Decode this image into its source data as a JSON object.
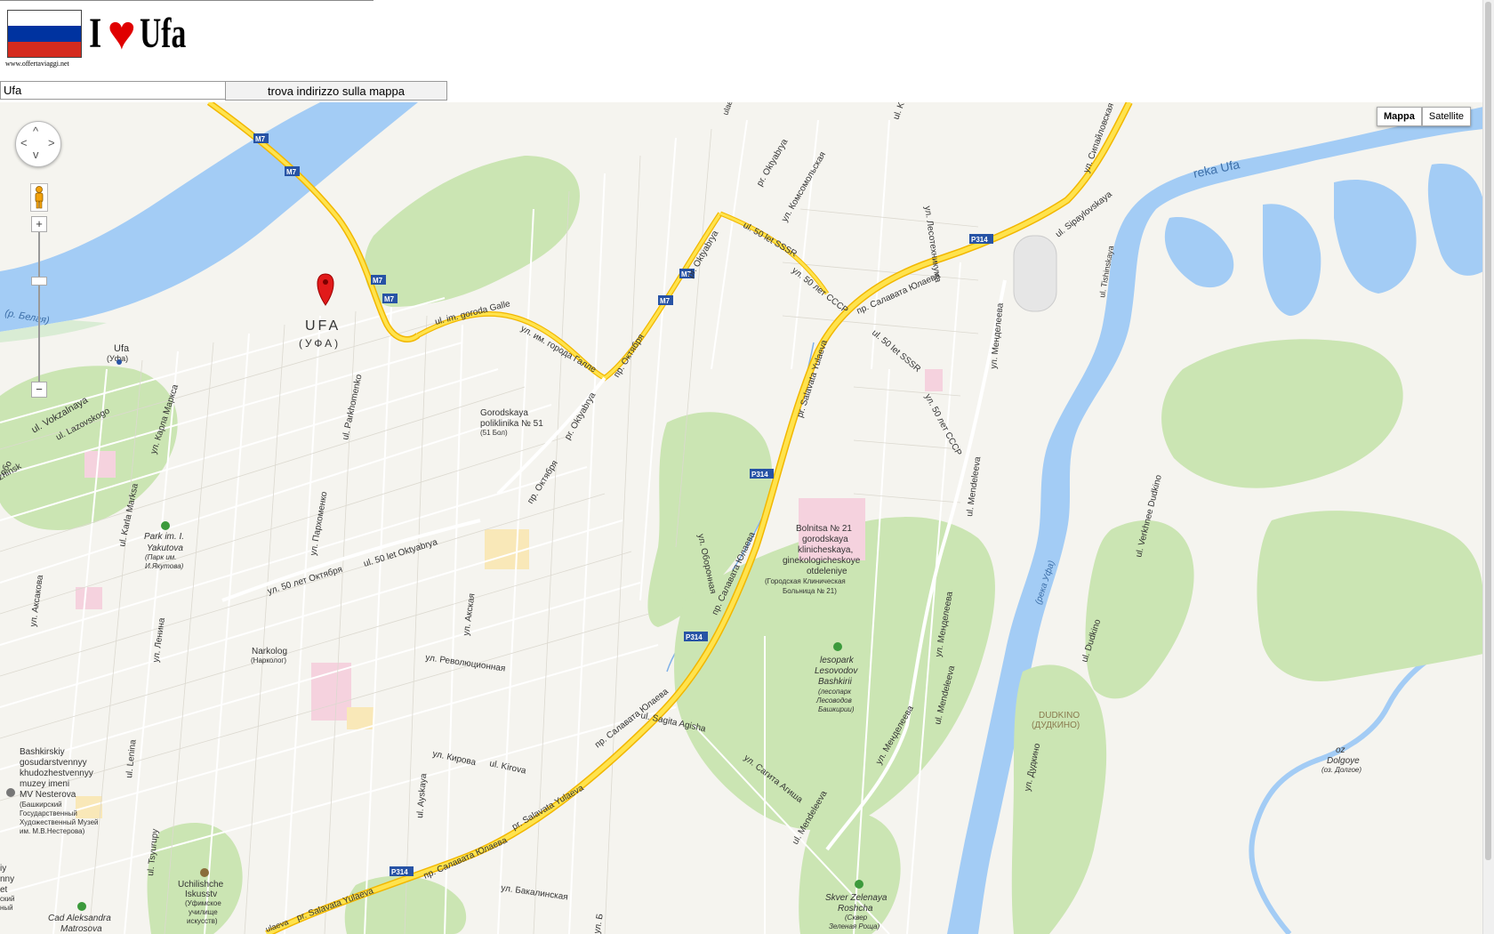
{
  "header": {
    "flag_colors": [
      "#ffffff",
      "#0033a0",
      "#d52b1e"
    ],
    "logo_i": "I",
    "logo_heart": "♥",
    "logo_city": "Ufa",
    "site_url": "www.offertaviaggi.net"
  },
  "search": {
    "address_value": "Ufa",
    "find_button_label": "trova indirizzo sulla mappa"
  },
  "map": {
    "type_buttons": [
      "Mappa",
      "Satellite"
    ],
    "selected_type": "Mappa",
    "zoom_in": "+",
    "zoom_out": "−",
    "marker_city": "UFA",
    "marker_city_ru": "(УФА)",
    "labels": {
      "reka_ufa": "reka Ufa",
      "r_belaya": "(р. Белая)",
      "ufa_station": "Ufa",
      "ufa_station_ru": "(Уфа)",
      "ul_vokzalnaya": "ul. Vokzalnaya",
      "ul_lazovskogo": "ul. Lazovskogo",
      "ul_karla_marksa_ru": "ул. Карла Маркса",
      "ul_karla_marksa": "ul. Karla Marksa",
      "park_yakutova_1": "Park im. I.",
      "park_yakutova_2": "Yakutova",
      "park_yakutova_3": "(Парк им.",
      "park_yakutova_4": "И.Якутова)",
      "ul_aksakova": "ул. Аксакова",
      "ul_lenina_ru": "ул. Ленина",
      "ul_lenina": "ul. Lenina",
      "ul_tsyurupy": "ul. Tsyurupy",
      "ul_parkhomenko": "ul. Parkhomenko",
      "ul_parkhomenko_ru": "ул. Пархоменко",
      "ul_50let_oktyabrya_ru": "ул. 50 лет Октября",
      "ul_50let_oktyabrya": "ul. 50 let Oktyabrya",
      "ul_im_goroda_galle": "ul. im. goroda Galle",
      "ul_im_goroda_galle_ru": "ул. им. города Галле",
      "pr_oktyabrya_ru": "пр. Октября",
      "pr_oktyabrya": "pr. Oktyabrya",
      "pr_oktyabrya_ru2": "пр. Октября",
      "pr_oktyabrya2": "pr. Oktyabrya",
      "pr_oktyabrya3": "pr. Oktyabrya",
      "gorod_polik_1": "Gorodskaya",
      "gorod_polik_2": "poliklinika № 51",
      "gorod_polik_3": "(51 Бол)",
      "ul_komsomolskaya": "ул. Комсомольская",
      "ul_50let_sssr": "ul. 50 let SSSR",
      "ul_50let_sssr_ru": "ул. 50 лет СССР",
      "ul_50let_sssr2": "ul. 50 let SSSR",
      "ul_50let_sssr_ru2": "ул. 50 лет СССР",
      "pr_salavata_ru": "пр. Салавата Юлаева",
      "pr_salavata": "pr. Salavata Yulaeva",
      "pr_salavata_ru2": "пр. Салавата Юлаева",
      "pr_salavata_ru3": "пр. Салавата Юлаева",
      "pr_salavata2": "pr. Salavata Yulaeva",
      "pr_salavata_ru4": "пр. Салавата Юлаева",
      "pr_salavata3": "pr. Salavata Yulaeva",
      "ul_sipaylovskaya": "ul. Sipaylovskaya",
      "ul_sipaylovskaya_ru": "ул. Сипайловская",
      "ul_mendeleeva_ru": "ул. Менделеева",
      "ul_mendeleeva": "ul. Mendeleeva",
      "ul_mendeleeva_ru2": "ул. Менделеева",
      "ul_mendeleeva2": "ul. Mendeleeva",
      "ul_mendeleeva_ru3": "ул. Менделеева",
      "ul_mendeleeva3": "ul. Mendeleeva",
      "ul_oboronnaya": "ул. Оборонная",
      "bolnitsa_1": "Bolnitsa № 21",
      "bolnitsa_2": "gorodskaya",
      "bolnitsa_3": "klinicheskaya,",
      "bolnitsa_4": "ginekologicheskoye",
      "bolnitsa_5": "otdeleniye",
      "bolnitsa_6": "(Городская Клиническая",
      "bolnitsa_7": "Больница № 21)",
      "lesopark_1": "lesopark",
      "lesopark_2": "Lesovodov",
      "lesopark_3": "Bashkirii",
      "lesopark_4": "(лесопарк",
      "lesopark_5": "Лесоводов",
      "lesopark_6": "Башкирии)",
      "ul_akskaya": "ул. Акская",
      "ul_ayskaya": "ul. Ayskaya",
      "ul_revolyutsionnaya": "ул. Революционная",
      "narkolog_1": "Narkolog",
      "narkolog_2": "(Нарколог)",
      "ul_sagita_agisha": "ul. Sagita Agisha",
      "ul_sagita_agisha_ru": "ул. Сагита Агиша",
      "ul_kirova_ru": "ул. Кирова",
      "ul_kirova": "ul. Kirova",
      "ul_bakalinskaya": "ул. Бакалинская",
      "museum_1": "Bashkirskiy",
      "museum_2": "gosudarstvennyy",
      "museum_3": "khudozhestvennyy",
      "museum_4": "muzey imeni",
      "museum_5": "MV Nesterova",
      "museum_6": "(Башкирский",
      "museum_7": "Государственный",
      "museum_8": "Художественный Музей",
      "museum_9": "им. М.В.Нестерова)",
      "uchilishche_1": "Uchilishche",
      "uchilishche_2": "Iskusstv",
      "uchilishche_3": "(Уфимское",
      "uchilishche_4": "училище",
      "uchilishche_5": "искусств)",
      "sad_1": "Cad Aleksandra",
      "sad_2": "Matrosova",
      "skver_1": "Skver Zelenaya",
      "skver_2": "Roshcha",
      "skver_3": "(Сквер",
      "skver_4": "Зеленая Роща)",
      "reka_ufa_ru": "(река Уфа)",
      "dudkino": "DUDKINO",
      "dudkino_ru": "(ДУДКИНО)",
      "ul_dudkino": "ul. Dudkino",
      "ul_dudkino_ru": "ул. Дудкино",
      "ul_verkhnee_dudkino": "ul. Verkhnee Dudkino",
      "oz_dolgoye_1": "oz",
      "oz_dolgoye_2": "Dolgoye",
      "oz_dolgoye_3": "(оз. Долгое)",
      "ul_tishinskaya": "ul. Tishinskaya",
      "ul_lesotekhnikuma": "ул. Лесотехникума",
      "ul_k": "ul. K",
      "oktyabrya_top": "pr. Oktyabrya",
      "top_ulyaeva": "ulaeva",
      "left_edge_1": "oбo",
      "left_edge_2": "zhinsk",
      "left_edge_3": "iy",
      "left_edge_4": "nny",
      "left_edge_5": "et",
      "left_edge_6": "ский",
      "left_edge_7": "ный",
      "bottom_ul_b": "ул. Б",
      "bottom_ulyaeva": "ulaeva"
    },
    "shields": {
      "m7": "M7",
      "p314": "P314"
    }
  }
}
